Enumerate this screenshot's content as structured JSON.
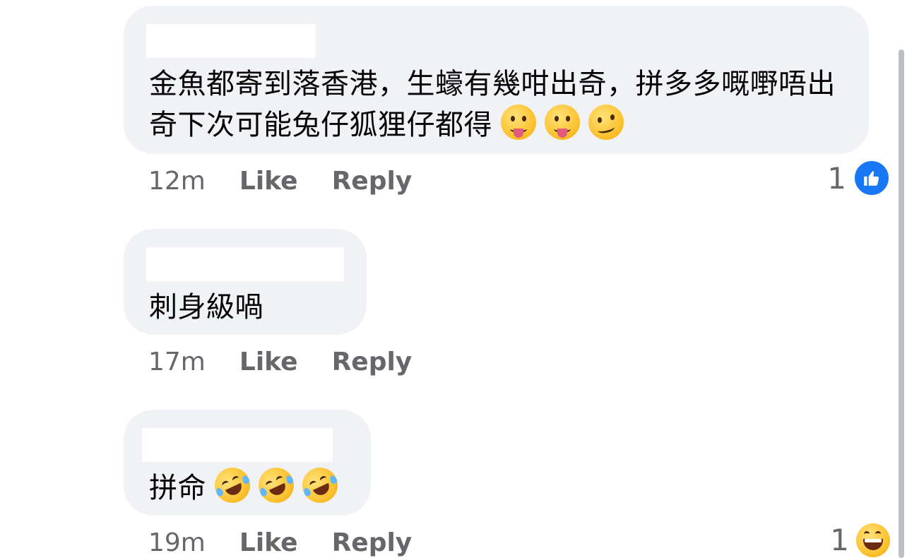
{
  "comments": [
    {
      "text": "金魚都寄到落香港，生蠔有幾咁出奇，拼多多嘅嘢唔出奇下次可能兔仔狐狸仔都得",
      "emojis": [
        "face-with-tongue",
        "face-with-tongue",
        "woozy-face"
      ],
      "time": "12m",
      "like_label": "Like",
      "reply_label": "Reply",
      "reaction_count": "1",
      "reaction_type": "like-icon"
    },
    {
      "text": "刺身級喎",
      "emojis": [],
      "time": "17m",
      "like_label": "Like",
      "reply_label": "Reply"
    },
    {
      "text": "拼命",
      "emojis": [
        "rolling-on-floor-laughing",
        "rolling-on-floor-laughing",
        "rolling-on-floor-laughing"
      ],
      "time": "19m",
      "like_label": "Like",
      "reply_label": "Reply",
      "reaction_count": "1",
      "reaction_type": "grinning-face-icon"
    }
  ],
  "colors": {
    "bubble_bg": "#f0f2f5",
    "meta_text": "#65676b",
    "like_blue": "#1877f2"
  }
}
